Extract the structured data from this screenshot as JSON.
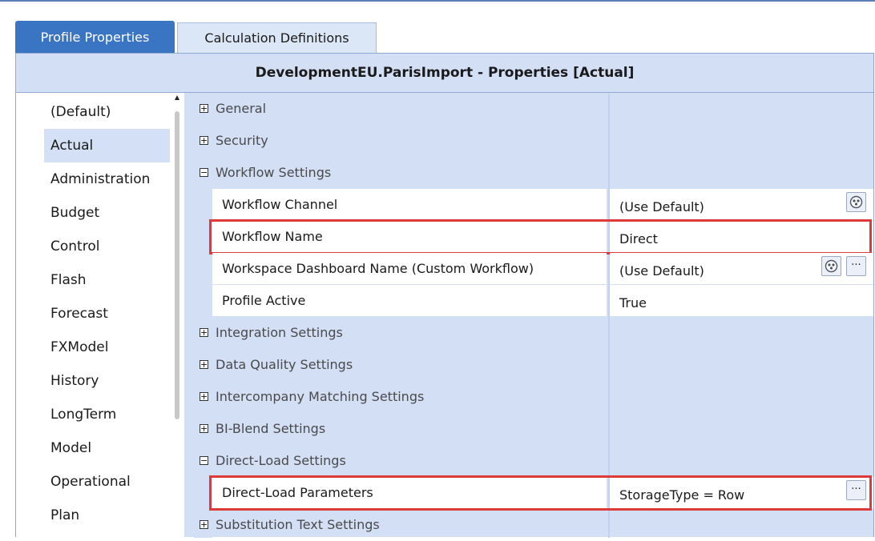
{
  "tabs": [
    {
      "label": "Profile Properties",
      "active": true
    },
    {
      "label": "Calculation Definitions",
      "active": false
    }
  ],
  "panel": {
    "title": "DevelopmentEU.ParisImport - Properties  [Actual]"
  },
  "scenarios": {
    "items": [
      "(Default)",
      "Actual",
      "Administration",
      "Budget",
      "Control",
      "Flash",
      "Forecast",
      "FXModel",
      "History",
      "LongTerm",
      "Model",
      "Operational",
      "Plan"
    ],
    "selected": "Actual"
  },
  "grid": {
    "rows": [
      {
        "kind": "category",
        "label": "General",
        "expander": "⊞"
      },
      {
        "kind": "category",
        "label": "Security",
        "expander": "⊞"
      },
      {
        "kind": "category",
        "label": "Workflow Settings",
        "expander": "⊟"
      },
      {
        "kind": "property",
        "name": "Workflow Channel",
        "value": "(Use Default)",
        "buttons": [
          "lookup-icon"
        ]
      },
      {
        "kind": "property",
        "name": "Workflow Name",
        "value": "Direct",
        "buttons": [],
        "highlighted": true
      },
      {
        "kind": "property",
        "name": "Workspace Dashboard Name (Custom Workflow)",
        "value": "(Use Default)",
        "buttons": [
          "lookup-icon",
          "ellipsis-icon"
        ]
      },
      {
        "kind": "property",
        "name": "Profile Active",
        "value": "True",
        "buttons": []
      },
      {
        "kind": "category",
        "label": "Integration Settings",
        "expander": "⊞"
      },
      {
        "kind": "category",
        "label": "Data Quality Settings",
        "expander": "⊞"
      },
      {
        "kind": "category",
        "label": "Intercompany Matching Settings",
        "expander": "⊞"
      },
      {
        "kind": "category",
        "label": "BI-Blend Settings",
        "expander": "⊞"
      },
      {
        "kind": "category",
        "label": "Direct-Load Settings",
        "expander": "⊟"
      },
      {
        "kind": "property",
        "name": "Direct-Load Parameters",
        "value": "StorageType = Row",
        "buttons": [
          "ellipsis-icon"
        ],
        "highlighted": true
      },
      {
        "kind": "category",
        "label": "Substitution Text Settings",
        "expander": "⊞"
      }
    ],
    "ellipsis_text": "···"
  },
  "colors": {
    "tab_active": "#3a75c4",
    "panel_bg": "#d3dff5",
    "highlight": "#e0393b",
    "selection": "#d4e0f5"
  }
}
